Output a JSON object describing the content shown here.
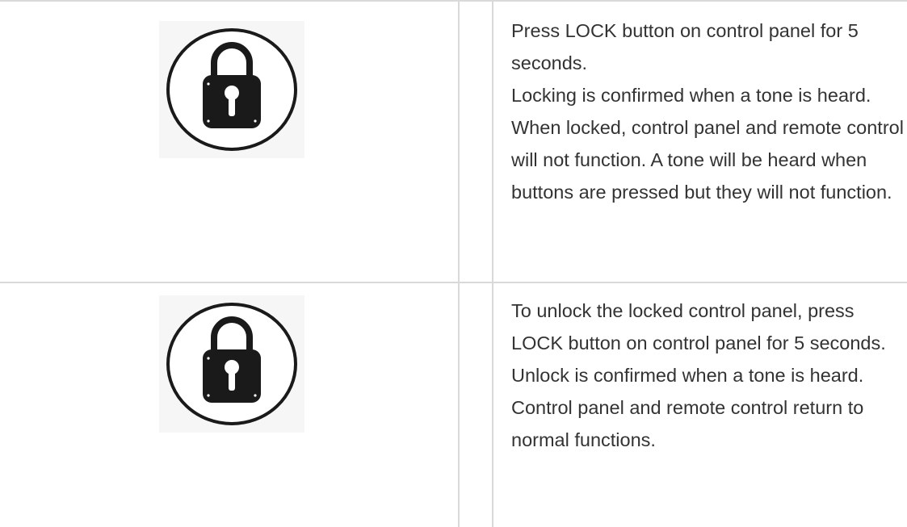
{
  "rows": [
    {
      "icon": "lock-icon",
      "text_1": "Press LOCK button on control panel for 5 seconds.",
      "text_2": "Locking is confirmed when a tone is heard. When locked, control panel and remote control will not function. A tone will be heard when buttons are pressed but they will not function."
    },
    {
      "icon": "lock-icon",
      "text_1": "To unlock the locked control panel, press LOCK button on control panel for 5 seconds. Unlock is confirmed when a tone is heard. Control panel and remote control return to normal functions."
    }
  ],
  "colors": {
    "border": "#d9d9d9",
    "text": "#333333",
    "icon_fill": "#1a1a1a",
    "icon_bg": "#f6f6f6"
  }
}
